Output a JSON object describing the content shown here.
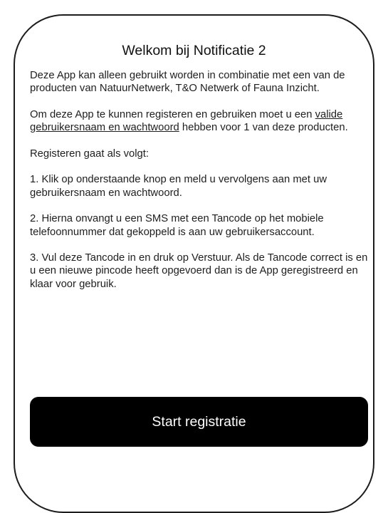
{
  "dialog": {
    "title": "Welkom bij Notificatie 2",
    "intro": "Deze App kan alleen gebruikt worden in combinatie met een van de producten van NatuurNetwerk, T&O Netwerk of Fauna Inzicht.",
    "requirement_before": "Om deze App te kunnen registeren en gebruiken moet u een ",
    "requirement_link": "valide gebruikersnaam en wachtwoord",
    "requirement_after": " hebben voor 1 van deze producten.",
    "steps_heading": "Registeren gaat als volgt:",
    "step1": "1. Klik op onderstaande knop en meld u vervolgens aan met uw gebruikersnaam en wachtwoord.",
    "step2": "2. Hierna onvangt u een SMS met een Tancode op het mobiele telefoonnummer dat gekoppeld is aan uw gebruikersaccount.",
    "step3": "3. Vul deze Tancode in en druk op Verstuur. Als de Tancode correct is en u een nieuwe pincode heeft opgevoerd dan is de App geregistreerd en klaar voor gebruik.",
    "start_button_label": "Start registratie"
  },
  "colors": {
    "background": "#ffffff",
    "border": "#1c1c1c",
    "button_background": "#000000",
    "button_text": "#ffffff"
  }
}
